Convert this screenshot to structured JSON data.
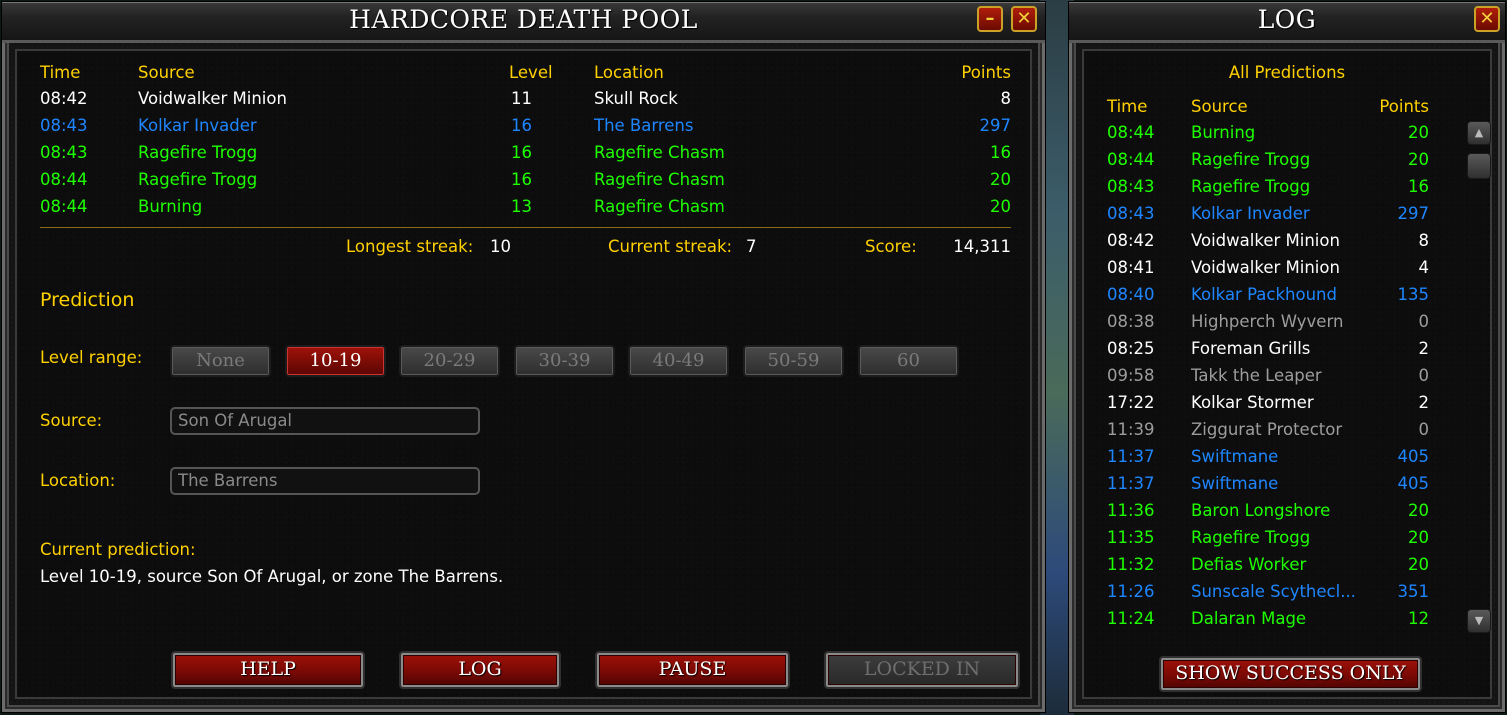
{
  "main": {
    "title": "HARDCORE DEATH POOL",
    "minimize_glyph": "–",
    "close_glyph": "✕",
    "columns": {
      "time": "Time",
      "source": "Source",
      "level": "Level",
      "location": "Location",
      "points": "Points"
    },
    "rows": [
      {
        "time": "08:42",
        "source": "Voidwalker Minion",
        "level": "11",
        "location": "Skull Rock",
        "points": "8",
        "color": "white"
      },
      {
        "time": "08:43",
        "source": "Kolkar Invader",
        "level": "16",
        "location": "The Barrens",
        "points": "297",
        "color": "blue"
      },
      {
        "time": "08:43",
        "source": "Ragefire Trogg",
        "level": "16",
        "location": "Ragefire Chasm",
        "points": "16",
        "color": "green"
      },
      {
        "time": "08:44",
        "source": "Ragefire Trogg",
        "level": "16",
        "location": "Ragefire Chasm",
        "points": "20",
        "color": "green"
      },
      {
        "time": "08:44",
        "source": "Burning",
        "level": "13",
        "location": "Ragefire Chasm",
        "points": "20",
        "color": "green"
      }
    ],
    "stats": {
      "longest_label": "Longest streak:",
      "longest_value": "10",
      "current_label": "Current streak:",
      "current_value": "7",
      "score_label": "Score:",
      "score_value": "14,311"
    },
    "prediction": {
      "heading": "Prediction",
      "level_range_label": "Level range:",
      "ranges": [
        "None",
        "10-19",
        "20-29",
        "30-39",
        "40-49",
        "50-59",
        "60"
      ],
      "selected_range": "10-19",
      "source_label": "Source:",
      "source_value": "Son Of Arugal",
      "location_label": "Location:",
      "location_value": "The Barrens",
      "current_label": "Current prediction:",
      "current_text": "Level 10-19, source Son Of Arugal, or zone The Barrens."
    },
    "buttons": {
      "help": "HELP",
      "log": "LOG",
      "pause": "PAUSE",
      "locked_in": "LOCKED IN"
    }
  },
  "log": {
    "title": "LOG",
    "close_glyph": "✕",
    "filter_heading": "All Predictions",
    "columns": {
      "time": "Time",
      "source": "Source",
      "points": "Points"
    },
    "rows": [
      {
        "time": "08:44",
        "source": "Burning",
        "points": "20",
        "color": "green"
      },
      {
        "time": "08:44",
        "source": "Ragefire Trogg",
        "points": "20",
        "color": "green"
      },
      {
        "time": "08:43",
        "source": "Ragefire Trogg",
        "points": "16",
        "color": "green"
      },
      {
        "time": "08:43",
        "source": "Kolkar Invader",
        "points": "297",
        "color": "blue"
      },
      {
        "time": "08:42",
        "source": "Voidwalker Minion",
        "points": "8",
        "color": "white"
      },
      {
        "time": "08:41",
        "source": "Voidwalker Minion",
        "points": "4",
        "color": "white"
      },
      {
        "time": "08:40",
        "source": "Kolkar Packhound",
        "points": "135",
        "color": "blue"
      },
      {
        "time": "08:38",
        "source": "Highperch Wyvern",
        "points": "0",
        "color": "gray"
      },
      {
        "time": "08:25",
        "source": "Foreman Grills",
        "points": "2",
        "color": "white"
      },
      {
        "time": "09:58",
        "source": "Takk the Leaper",
        "points": "0",
        "color": "gray"
      },
      {
        "time": "17:22",
        "source": "Kolkar Stormer",
        "points": "2",
        "color": "white"
      },
      {
        "time": "11:39",
        "source": "Ziggurat Protector",
        "points": "0",
        "color": "gray"
      },
      {
        "time": "11:37",
        "source": "Swiftmane",
        "points": "405",
        "color": "blue"
      },
      {
        "time": "11:37",
        "source": "Swiftmane",
        "points": "405",
        "color": "blue"
      },
      {
        "time": "11:36",
        "source": "Baron Longshore",
        "points": "20",
        "color": "green"
      },
      {
        "time": "11:35",
        "source": "Ragefire Trogg",
        "points": "20",
        "color": "green"
      },
      {
        "time": "11:32",
        "source": "Defias Worker",
        "points": "20",
        "color": "green"
      },
      {
        "time": "11:26",
        "source": "Sunscale Scythecl...",
        "points": "351",
        "color": "blue"
      },
      {
        "time": "11:24",
        "source": "Dalaran Mage",
        "points": "12",
        "color": "green"
      }
    ],
    "show_success_button": "SHOW SUCCESS ONLY"
  },
  "colors": {
    "white": "#ffffff",
    "blue": "#1e86ff",
    "green": "#1eff00",
    "gray": "#9d9d9d",
    "yellow": "#ffd100"
  }
}
